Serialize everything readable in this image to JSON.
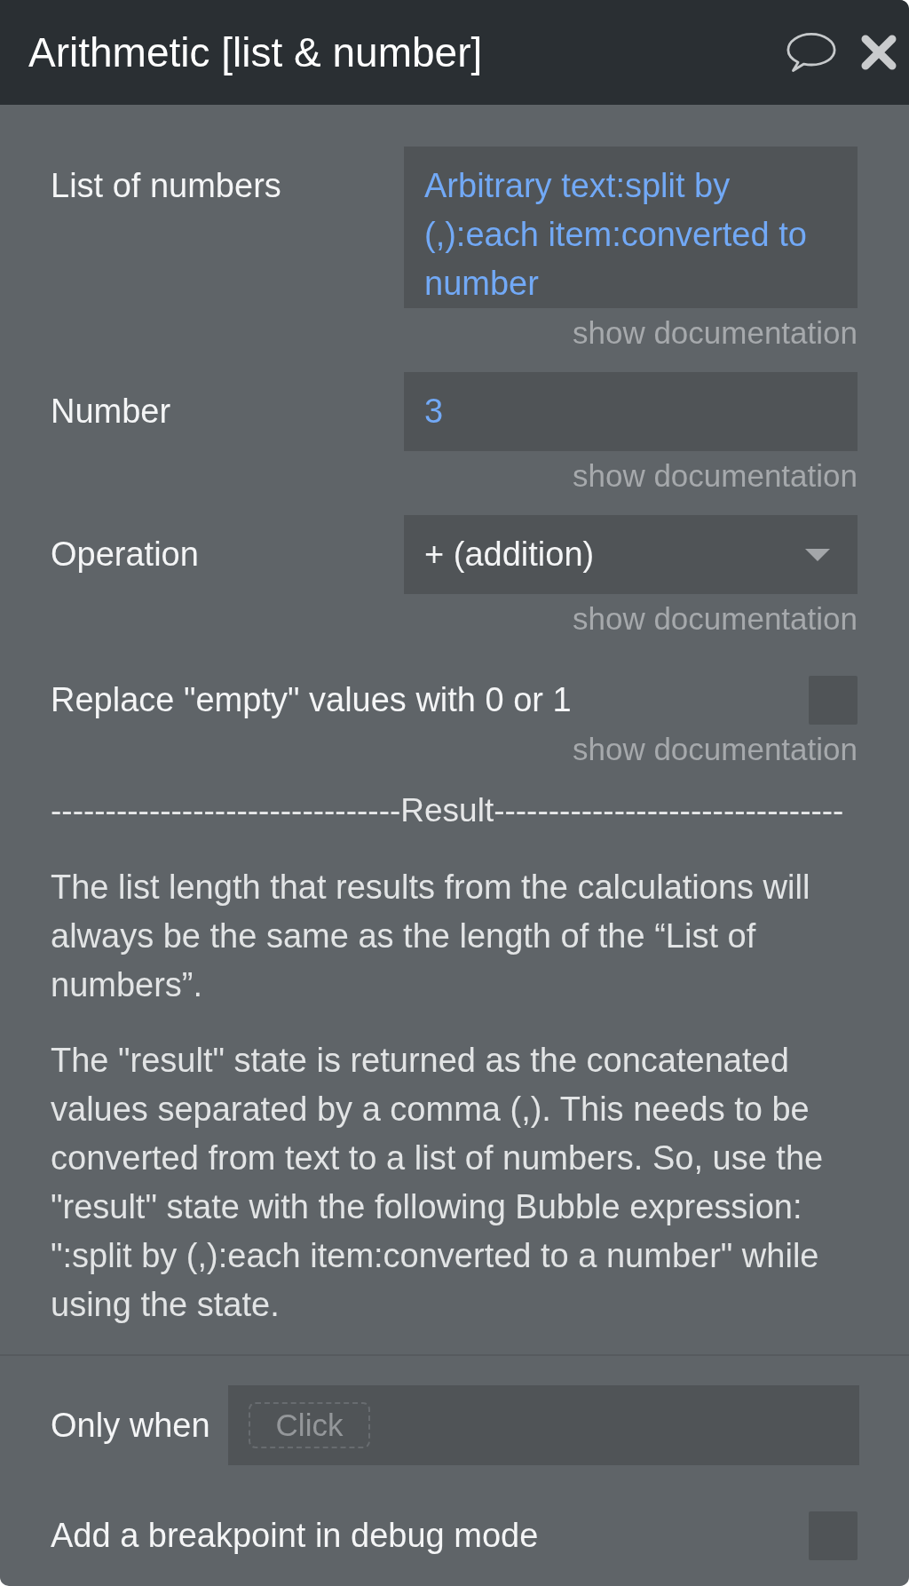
{
  "header": {
    "title": "Arithmetic [list & number]"
  },
  "fields": [
    {
      "kind": "expression",
      "label": "List of numbers",
      "value": "Arbitrary text:split by (,):each item:converted to number",
      "link": "show documentation"
    },
    {
      "kind": "expression",
      "label": "Number",
      "value": "3",
      "link": "show documentation"
    },
    {
      "kind": "dropdown",
      "label": "Operation",
      "value": "+ (addition)",
      "link": "show documentation"
    },
    {
      "kind": "checkbox",
      "label": "Replace \"empty\" values with 0 or 1",
      "checked": false,
      "link": "show documentation"
    }
  ],
  "result": {
    "heading": "--------------------------------Result--------------------------------",
    "paragraphs": [
      "The list length that results from the calculations will always be the same as the length of the “List of numbers”.",
      "The \"result\" state is returned as the concatenated values separated by a comma (,). This needs to be converted from text to a list of numbers. So, use the \"result\" state with the following Bubble expression: \":split by (,):each item:converted to a number\" while using the state."
    ]
  },
  "only_when": {
    "label": "Only when",
    "placeholder": "Click"
  },
  "breakpoint": {
    "label": "Add a breakpoint in debug mode",
    "checked": false
  }
}
